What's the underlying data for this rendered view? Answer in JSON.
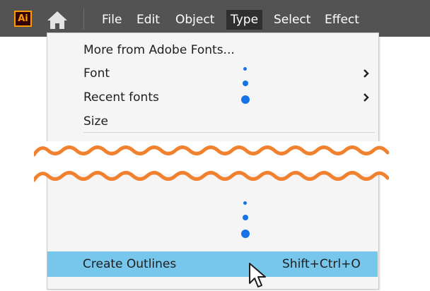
{
  "app": {
    "logo_text": "Ai",
    "logo_color": "#ff9a00"
  },
  "menubar": {
    "home_icon": "home-icon",
    "items": [
      {
        "label": "File"
      },
      {
        "label": "Edit"
      },
      {
        "label": "Object"
      },
      {
        "label": "Type",
        "active": true
      },
      {
        "label": "Select"
      },
      {
        "label": "Effect"
      }
    ]
  },
  "type_menu": {
    "items": [
      {
        "label": "More from Adobe Fonts..."
      },
      {
        "label": "Font",
        "submenu": true
      },
      {
        "label": "Recent fonts",
        "submenu": true
      },
      {
        "label": "Size"
      }
    ],
    "highlighted_item": {
      "label": "Create Outlines",
      "shortcut": "Shift+Ctrl+O"
    }
  },
  "colors": {
    "menubar": "#535353",
    "highlight": "#77c6ec",
    "ellipsis_dots": "#1473e6",
    "break_wave": "#f0812f"
  }
}
